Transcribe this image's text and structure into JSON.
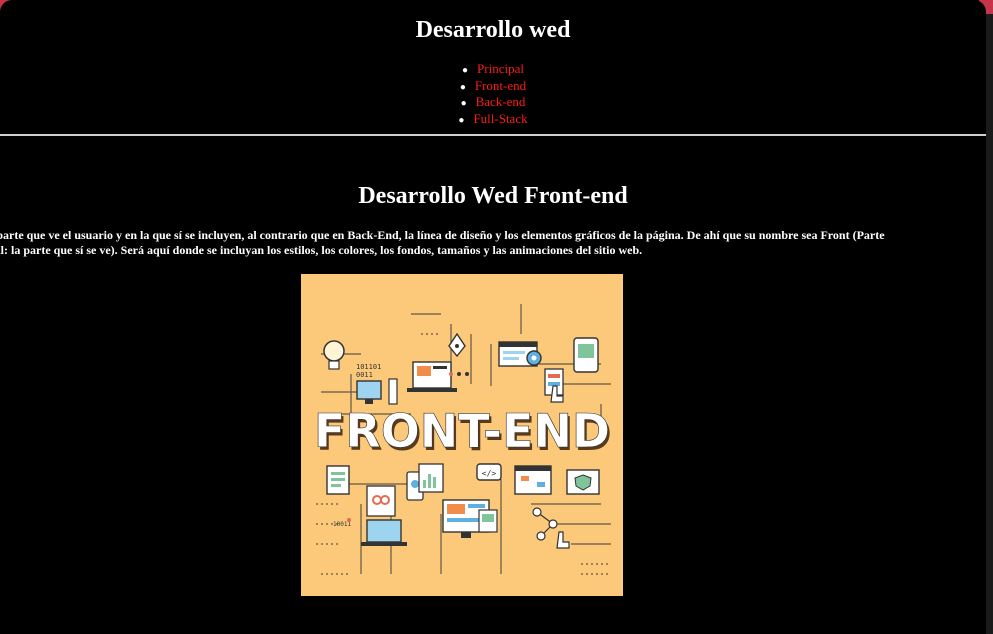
{
  "header": {
    "title": "Desarrollo wed",
    "nav": [
      {
        "label": "Principal"
      },
      {
        "label": "Front-end"
      },
      {
        "label": "Back-end"
      },
      {
        "label": "Full-Stack"
      }
    ]
  },
  "main": {
    "title": "Desarrollo Wed Front-end",
    "paragraph_line1": "la parte que ve el usuario y en la que sí se incluyen, al contrario que en Back-End, la línea de diseño y los elementos gráficos de la página. De ahí que su nombre sea Front (Parte",
    "paragraph_line2": "ntal: la parte que sí se ve). Será aquí donde se incluyan los estilos, los colores, los fondos, tamaños y las animaciones del sitio web.",
    "image": {
      "text": "FRONT-END",
      "code_text_1": "101101",
      "code_text_2": "0011",
      "code_text_3": "10011"
    }
  },
  "colors": {
    "background": "#000000",
    "link": "#ff1a1a",
    "image_bg": "#fcc97a",
    "window_accent": "#c8344a"
  }
}
